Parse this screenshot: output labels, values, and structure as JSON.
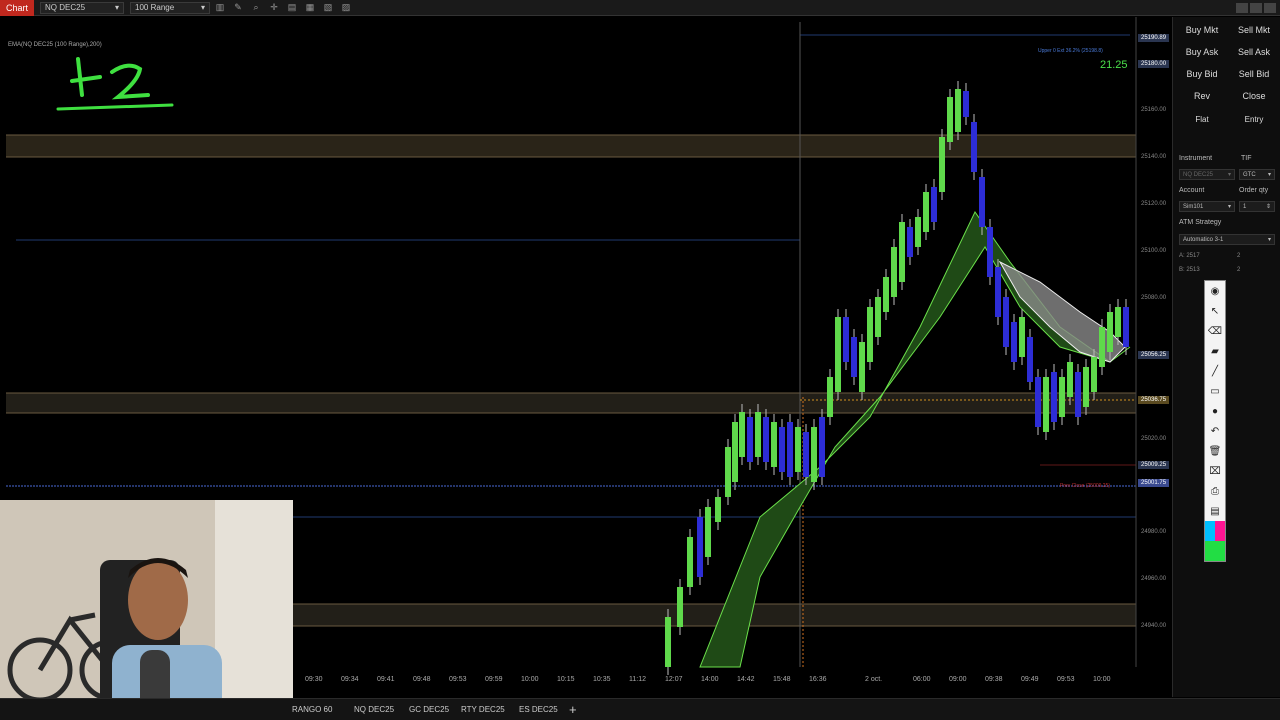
{
  "toolbar": {
    "chart_tab": "Chart",
    "instrument": "NQ DEC25",
    "interval": "100 Range"
  },
  "chart": {
    "indicator_label": "EMA(NQ DEC25 (100 Range),200)",
    "counter_value": "21.25",
    "upper_label": "Upper 0 Ext 36.2% (25198.8)",
    "lower_label": "Prev Close (25009.25)",
    "price_axis": [
      "25180.00",
      "25160.00",
      "25140.00",
      "25120.00",
      "25100.00",
      "25080.00",
      "25060.00",
      "25040.00",
      "25020.00",
      "24980.00",
      "24960.00",
      "24940.00"
    ],
    "price_tags": [
      "25190.89",
      "25180.00",
      "25056.25",
      "25036.75",
      "25009.25",
      "25001.75"
    ],
    "time_axis": [
      "09:30",
      "09:34",
      "09:41",
      "09:48",
      "09:53",
      "09:59",
      "10:00",
      "10:15",
      "10:35",
      "11:12",
      "12:07",
      "14:00",
      "14:42",
      "15:48",
      "16:36",
      "2 oct.",
      "06:00",
      "09:00",
      "09:38",
      "09:49",
      "09:53",
      "10:00"
    ]
  },
  "tabs": [
    "RANGO 60",
    "NQ DEC25",
    "GC DEC25",
    "RTY DEC25",
    "ES DEC25"
  ],
  "order_panel": {
    "buy_mkt": "Buy Mkt",
    "sell_mkt": "Sell Mkt",
    "buy_ask": "Buy Ask",
    "sell_ask": "Sell Ask",
    "buy_bid": "Buy Bid",
    "sell_bid": "Sell Bid",
    "rev": "Rev",
    "close": "Close",
    "flat": "Flat",
    "entry": "Entry",
    "instrument_label": "Instrument",
    "tif_label": "TIF",
    "instrument_value": "NQ DEC25",
    "tif_value": "GTC",
    "account_label": "Account",
    "order_qty_label": "Order qty",
    "account_value": "Sim101",
    "qty_value": "1",
    "atm_label": "ATM Strategy",
    "atm_value": "Automatico 3-1",
    "a_label": "A: 2517",
    "b_label": "B: 2513",
    "a_qty": "2",
    "b_qty": "2"
  },
  "colors": {
    "bull_candle": "#5fd94b",
    "bear_candle": "#2d2dd6",
    "ribbon": "#3a8a2a",
    "chart_bg": "#000000",
    "accent_red": "#c0281e"
  }
}
